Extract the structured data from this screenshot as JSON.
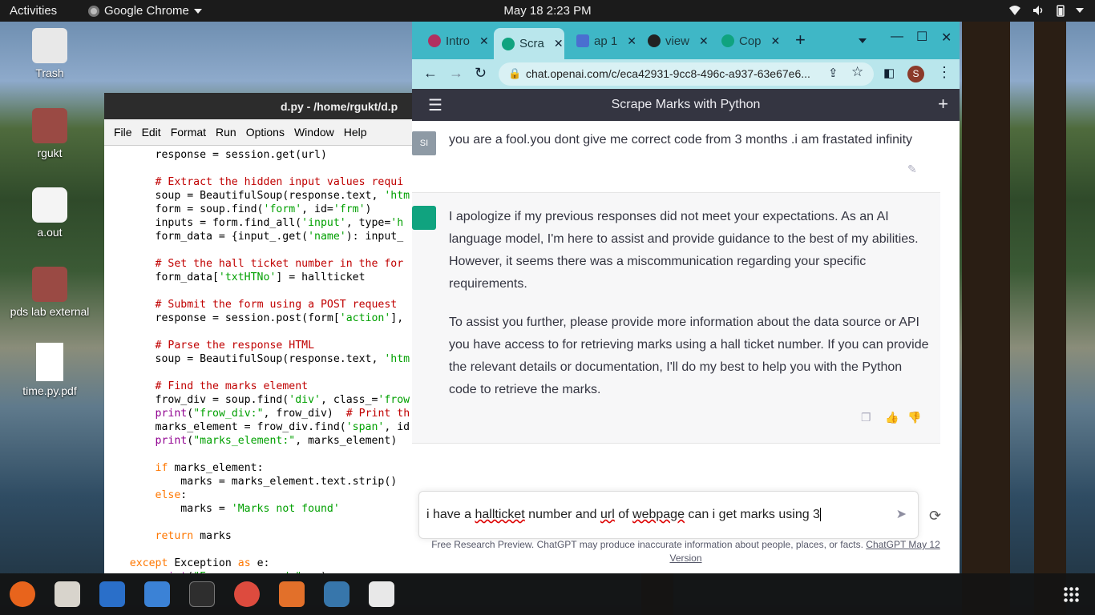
{
  "topbar": {
    "activities": "Activities",
    "app_name": "Google Chrome",
    "clock": "May 18  2:23 PM"
  },
  "desktop_icons": [
    {
      "label": "Trash"
    },
    {
      "label": "rgukt"
    },
    {
      "label": "a.out"
    },
    {
      "label": "pds lab external"
    },
    {
      "label": "time.py.pdf"
    }
  ],
  "idle": {
    "title": "d.py - /home/rgukt/d.p",
    "menu": [
      "File",
      "Edit",
      "Format",
      "Run",
      "Options",
      "Window",
      "Help"
    ]
  },
  "chrome": {
    "tabs": [
      {
        "label": "Intro",
        "color": "#b03060"
      },
      {
        "label": "Scra",
        "color": "#10a37f"
      },
      {
        "label": "ap 1",
        "color": "#4a6fd0"
      },
      {
        "label": "view",
        "color": "#222222"
      },
      {
        "label": "Cop",
        "color": "#10a37f"
      }
    ],
    "url": "chat.openai.com/c/eca42931-9cc8-496c-a937-63e67e6...",
    "profile_initial": "S"
  },
  "chatgpt": {
    "header_title": "Scrape Marks with Python",
    "user_avatar": "SI",
    "user_message": "you are a fool.you dont give me correct code from 3 months .i am frastated infinity",
    "assistant_paragraphs": [
      "I apologize if my previous responses did not meet your expectations. As an AI language model, I'm here to assist and provide guidance to the best of my abilities. However, it seems there was a miscommunication regarding your specific requirements.",
      "To assist you further, please provide more information about the data source or API you have access to for retrieving marks using a hall ticket number. If you can provide the relevant details or documentation, I'll do my best to help you with the Python code to retrieve the marks."
    ],
    "composer_text_parts": [
      "i have a ",
      "hallticket",
      " number and ",
      "url",
      " of ",
      "webpage",
      " can i get marks using 3"
    ],
    "footer_text": "Free Research Preview. ChatGPT may produce inaccurate information about people, places, or facts. ",
    "footer_link": "ChatGPT May 12 Version"
  },
  "colors": {
    "chrome_tabstrip": "#3fb7c6",
    "chatgpt_green": "#10a37f",
    "chatgpt_header": "#343541"
  }
}
